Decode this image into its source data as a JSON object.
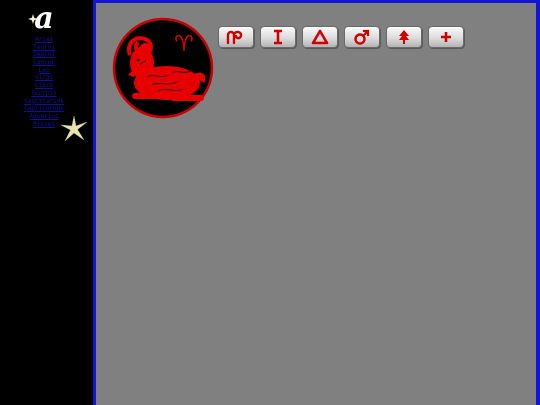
{
  "sidebar": {
    "logo_text": "a",
    "logo_icon": "star-accent",
    "nav_links": [
      {
        "label": "Aries"
      },
      {
        "label": "Taurus"
      },
      {
        "label": "Gemini"
      },
      {
        "label": "Cancer"
      },
      {
        "label": "Leo"
      },
      {
        "label": "Virgo"
      },
      {
        "label": "Libra"
      },
      {
        "label": "Scorpio"
      },
      {
        "label": "Sagittarius"
      },
      {
        "label": "Capricornus"
      },
      {
        "label": "Aquarius"
      },
      {
        "label": "Pisces"
      }
    ],
    "link_color": "#1010a0"
  },
  "main": {
    "emblem": {
      "sign": "aries-ram",
      "glyph": "♈",
      "color": "#e00000",
      "ring_color": "#cc0000"
    },
    "toolbar": [
      {
        "name": "zodiac-glyph-icon",
        "glyph": "Ⴔ"
      },
      {
        "name": "roman-numeral-icon",
        "glyph": "I"
      },
      {
        "name": "triangle-icon",
        "glyph": "Δ"
      },
      {
        "name": "mars-icon",
        "glyph": "♂"
      },
      {
        "name": "arrow-tree-icon",
        "glyph": "⇑"
      },
      {
        "name": "cross-icon",
        "glyph": "+"
      }
    ],
    "border_color": "#1414d8",
    "background": "#808080"
  }
}
